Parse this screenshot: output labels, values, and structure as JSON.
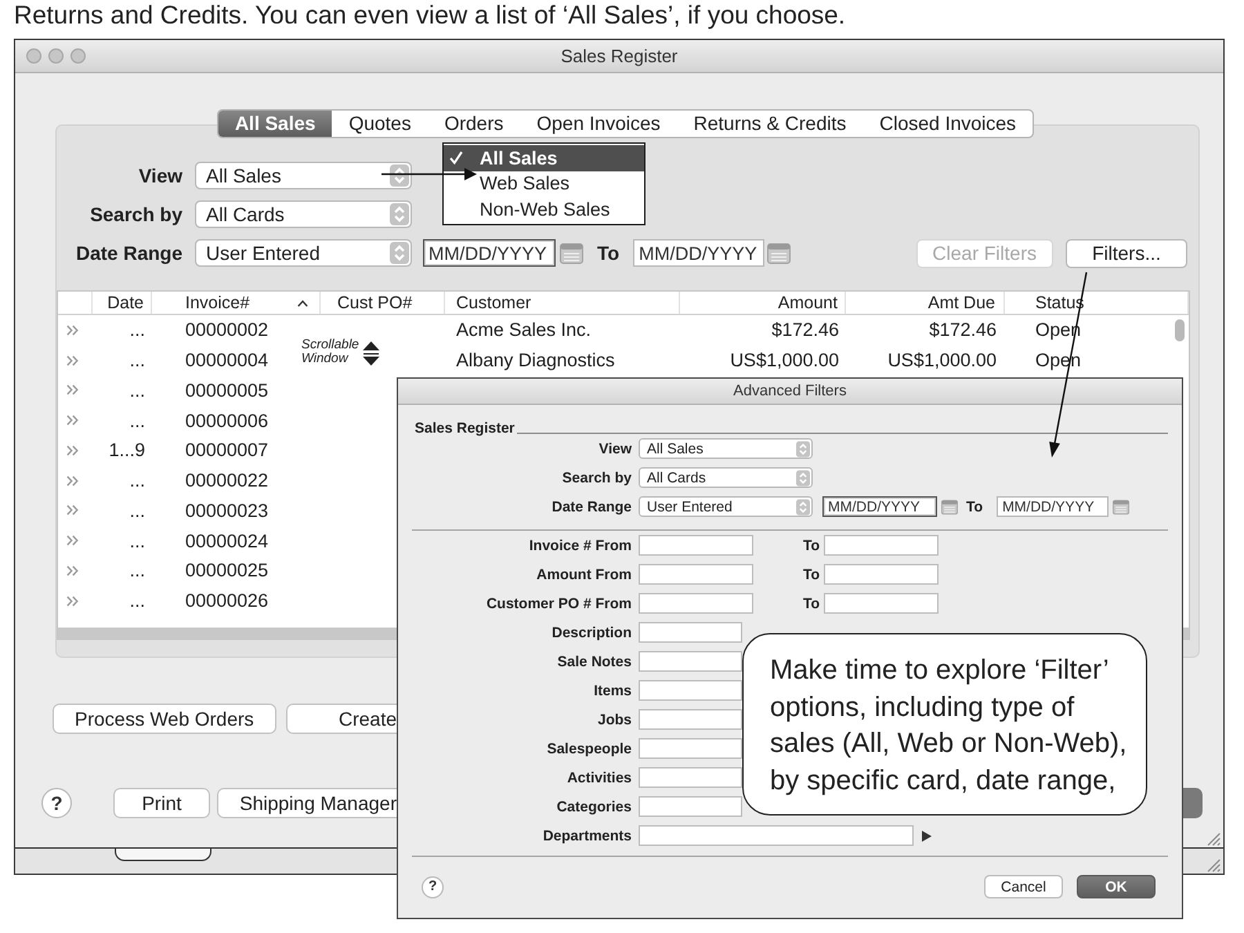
{
  "caption": "Returns and Credits. You can even view a list of ‘All Sales’, if you choose.",
  "window": {
    "title": "Sales Register"
  },
  "tabs": [
    {
      "label": "All Sales",
      "selected": true
    },
    {
      "label": "Quotes",
      "selected": false
    },
    {
      "label": "Orders",
      "selected": false
    },
    {
      "label": "Open Invoices",
      "selected": false
    },
    {
      "label": "Returns & Credits",
      "selected": false
    },
    {
      "label": "Closed Invoices",
      "selected": false
    }
  ],
  "filters": {
    "view": {
      "label": "View",
      "value": "All Sales"
    },
    "search_by": {
      "label": "Search by",
      "value": "All Cards"
    },
    "date_range": {
      "label": "Date Range",
      "value": "User Entered",
      "from": {
        "placeholder": "MM/DD/YYYY",
        "focused": true
      },
      "to_label": "To",
      "to": {
        "placeholder": "MM/DD/YYYY",
        "focused": false
      }
    },
    "buttons": [
      {
        "label": "Clear Filters",
        "disabled": true
      },
      {
        "label": "Filters...",
        "disabled": false
      }
    ]
  },
  "view_menu": {
    "items": [
      {
        "label": "All Sales",
        "checked": true,
        "selected": true
      },
      {
        "label": "Web Sales",
        "checked": false,
        "selected": false
      },
      {
        "label": "Non-Web Sales",
        "checked": false,
        "selected": false
      }
    ]
  },
  "table": {
    "columns": [
      {
        "label": "Date",
        "sorted": false
      },
      {
        "label": "Invoice#",
        "sorted": true
      },
      {
        "label": "Cust PO#",
        "sorted": false
      },
      {
        "label": "Customer",
        "sorted": false
      },
      {
        "label": "Amount",
        "sorted": false
      },
      {
        "label": "Amt Due",
        "sorted": false
      },
      {
        "label": "Status",
        "sorted": false
      }
    ],
    "rows": [
      {
        "date": "...",
        "invoice": "00000002",
        "customer": "Acme Sales Inc.",
        "amount": "$172.46",
        "amt_due": "$172.46",
        "status": "Open"
      },
      {
        "date": "...",
        "invoice": "00000004",
        "customer": "Albany Diagnostics",
        "amount": "US$1,000.00",
        "amt_due": "US$1,000.00",
        "status": "Open"
      },
      {
        "date": "...",
        "invoice": "00000005"
      },
      {
        "date": "...",
        "invoice": "00000006"
      },
      {
        "date": "1...9",
        "invoice": "00000007"
      },
      {
        "date": "...",
        "invoice": "00000022"
      },
      {
        "date": "...",
        "invoice": "00000023"
      },
      {
        "date": "...",
        "invoice": "00000024"
      },
      {
        "date": "...",
        "invoice": "00000025"
      },
      {
        "date": "...",
        "invoice": "00000026"
      }
    ]
  },
  "scroll_note": "Scrollable Window",
  "actions": [
    "Process Web Orders",
    "Create"
  ],
  "footer": {
    "help_button": "?",
    "buttons": [
      "Print",
      "Shipping Manager"
    ]
  },
  "advanced_filters": {
    "title": "Advanced Filters",
    "group": "Sales Register",
    "view": {
      "label": "View",
      "value": "All Sales"
    },
    "search_by": {
      "label": "Search by",
      "value": "All Cards"
    },
    "date_range": {
      "label": "Date Range",
      "value": "User Entered",
      "from": {
        "placeholder": "MM/DD/YYYY",
        "focused": true
      },
      "to_label": "To",
      "to": {
        "placeholder": "MM/DD/YYYY",
        "focused": false
      }
    },
    "range_fields": [
      {
        "label": "Invoice # From",
        "to_label": "To"
      },
      {
        "label": "Amount From",
        "to_label": "To"
      },
      {
        "label": "Customer PO # From",
        "to_label": "To"
      }
    ],
    "text_fields": [
      {
        "label": "Description",
        "kind": "text"
      },
      {
        "label": "Sale Notes",
        "kind": "text"
      },
      {
        "label": "Items",
        "kind": "text"
      },
      {
        "label": "Jobs",
        "kind": "text"
      },
      {
        "label": "Salespeople",
        "kind": "text"
      },
      {
        "label": "Activities",
        "kind": "text"
      },
      {
        "label": "Categories",
        "kind": "text"
      },
      {
        "label": "Departments",
        "kind": "picker"
      }
    ],
    "help_button": "?",
    "buttons": [
      {
        "label": "Cancel",
        "default": false
      },
      {
        "label": "OK",
        "default": true
      }
    ]
  },
  "callout": "Make time to explore ‘Filter’ options, including type of sales (All, Web or Non-Web), by specific card, date range,"
}
